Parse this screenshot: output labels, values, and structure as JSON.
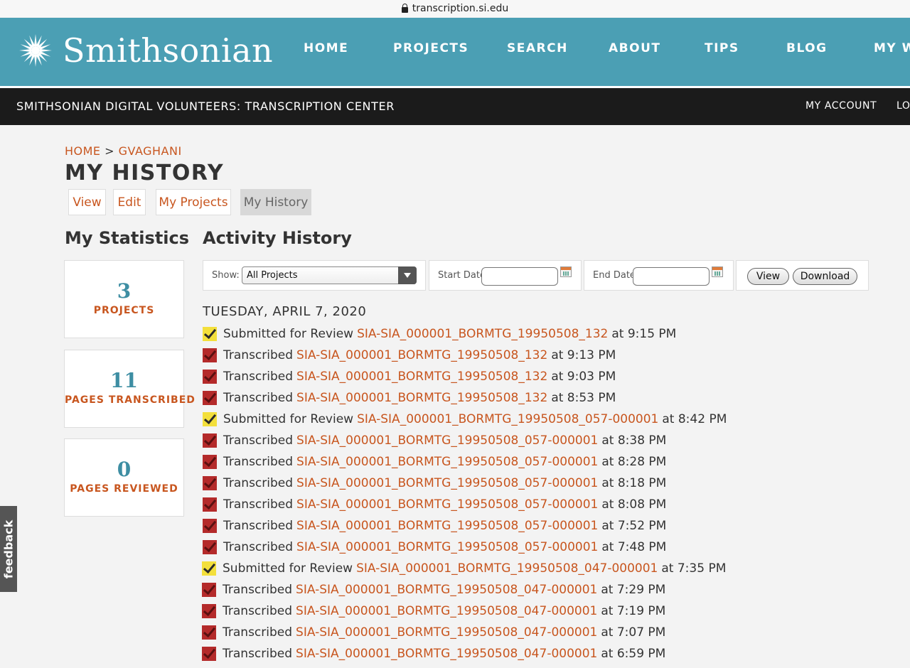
{
  "browser": {
    "url": "transcription.si.edu"
  },
  "header": {
    "logo_text": "Smithsonian",
    "nav": [
      "HOME",
      "PROJECTS",
      "SEARCH",
      "ABOUT",
      "TIPS",
      "BLOG",
      "MY W"
    ],
    "bg_color": "#4b9fb4"
  },
  "subheader": {
    "site_title": "SMITHSONIAN DIGITAL VOLUNTEERS: TRANSCRIPTION CENTER",
    "my_account": "MY ACCOUNT",
    "logout": "LO"
  },
  "breadcrumb": {
    "home": "HOME",
    "sep": ">",
    "user": "GVAGHANI"
  },
  "page_title": "MY HISTORY",
  "tabs": [
    {
      "label": "View",
      "active": false
    },
    {
      "label": "Edit",
      "active": false
    },
    {
      "label": "My Projects",
      "active": false
    },
    {
      "label": "My History",
      "active": true
    }
  ],
  "statistics": {
    "heading": "My Statistics",
    "items": [
      {
        "value": "3",
        "label": "PROJECTS"
      },
      {
        "value": "11",
        "label": "PAGES TRANSCRIBED"
      },
      {
        "value": "0",
        "label": "PAGES REVIEWED"
      }
    ]
  },
  "activity": {
    "heading": "Activity History",
    "filters": {
      "show_label": "Show:",
      "show_value": "All Projects",
      "start_label": "Start Date",
      "start_value": "",
      "end_label": "End Date",
      "end_value": "",
      "view_button": "View",
      "download_button": "Download"
    },
    "day": "TUESDAY, APRIL 7, 2020",
    "entries": [
      {
        "type": "submitted",
        "action": "Submitted for Review",
        "item": "SIA-SIA_000001_BORMTG_19950508_132",
        "time": "at 9:15 PM"
      },
      {
        "type": "transcribed",
        "action": "Transcribed",
        "item": "SIA-SIA_000001_BORMTG_19950508_132",
        "time": "at 9:13 PM"
      },
      {
        "type": "transcribed",
        "action": "Transcribed",
        "item": "SIA-SIA_000001_BORMTG_19950508_132",
        "time": "at 9:03 PM"
      },
      {
        "type": "transcribed",
        "action": "Transcribed",
        "item": "SIA-SIA_000001_BORMTG_19950508_132",
        "time": "at 8:53 PM"
      },
      {
        "type": "submitted",
        "action": "Submitted for Review",
        "item": "SIA-SIA_000001_BORMTG_19950508_057-000001",
        "time": "at 8:42 PM"
      },
      {
        "type": "transcribed",
        "action": "Transcribed",
        "item": "SIA-SIA_000001_BORMTG_19950508_057-000001",
        "time": "at 8:38 PM"
      },
      {
        "type": "transcribed",
        "action": "Transcribed",
        "item": "SIA-SIA_000001_BORMTG_19950508_057-000001",
        "time": "at 8:28 PM"
      },
      {
        "type": "transcribed",
        "action": "Transcribed",
        "item": "SIA-SIA_000001_BORMTG_19950508_057-000001",
        "time": "at 8:18 PM"
      },
      {
        "type": "transcribed",
        "action": "Transcribed",
        "item": "SIA-SIA_000001_BORMTG_19950508_057-000001",
        "time": "at 8:08 PM"
      },
      {
        "type": "transcribed",
        "action": "Transcribed",
        "item": "SIA-SIA_000001_BORMTG_19950508_057-000001",
        "time": "at 7:52 PM"
      },
      {
        "type": "transcribed",
        "action": "Transcribed",
        "item": "SIA-SIA_000001_BORMTG_19950508_057-000001",
        "time": "at 7:48 PM"
      },
      {
        "type": "submitted",
        "action": "Submitted for Review",
        "item": "SIA-SIA_000001_BORMTG_19950508_047-000001",
        "time": "at 7:35 PM"
      },
      {
        "type": "transcribed",
        "action": "Transcribed",
        "item": "SIA-SIA_000001_BORMTG_19950508_047-000001",
        "time": "at 7:29 PM"
      },
      {
        "type": "transcribed",
        "action": "Transcribed",
        "item": "SIA-SIA_000001_BORMTG_19950508_047-000001",
        "time": "at 7:19 PM"
      },
      {
        "type": "transcribed",
        "action": "Transcribed",
        "item": "SIA-SIA_000001_BORMTG_19950508_047-000001",
        "time": "at 7:07 PM"
      },
      {
        "type": "transcribed",
        "action": "Transcribed",
        "item": "SIA-SIA_000001_BORMTG_19950508_047-000001",
        "time": "at 6:59 PM"
      }
    ]
  },
  "feedback_label": "feedback"
}
